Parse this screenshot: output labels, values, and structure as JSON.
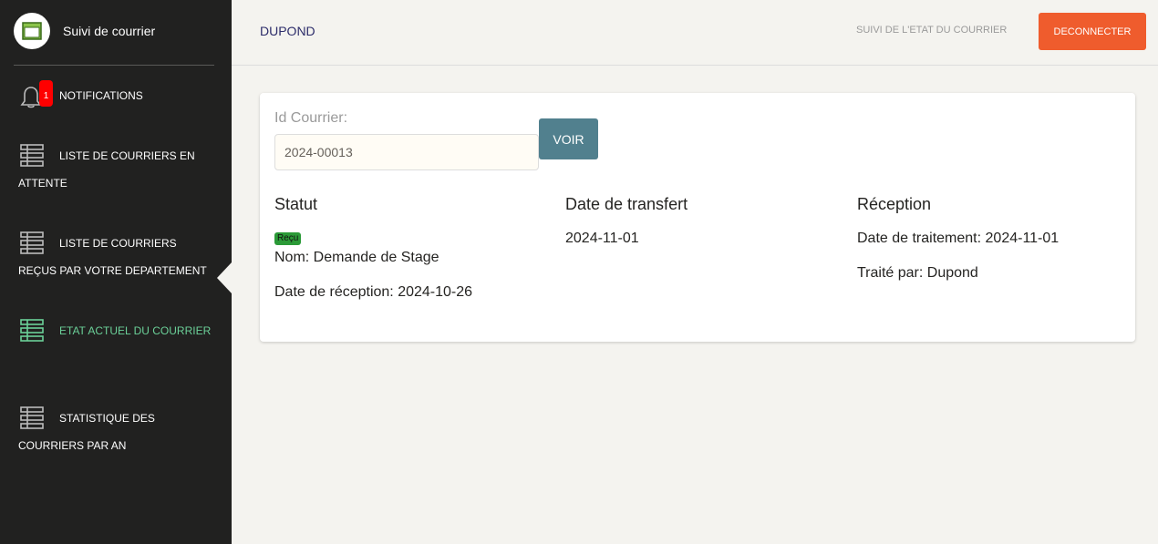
{
  "sidebar": {
    "brand_title": "Suivi de courrier",
    "notification_count": "1",
    "items": [
      {
        "label": "NOTIFICATIONS",
        "icon": "bell-icon"
      },
      {
        "label": "LISTE DE COURRIERS EN ATTENTE",
        "icon": "list-icon"
      },
      {
        "label": "LISTE DE COURRIERS REÇUS PAR VOTRE DEPARTEMENT",
        "icon": "list-icon"
      },
      {
        "label": "ETAT ACTUEL DU COURRIER",
        "icon": "list-icon",
        "active": true
      },
      {
        "label": "STATISTIQUE DES COURRIERS PAR AN",
        "icon": "list-icon"
      }
    ]
  },
  "header": {
    "user_name": "DUPOND",
    "nav_link": "SUIVI DE L'ETAT DU COURRIER",
    "logout_label": "DECONNECTER"
  },
  "form": {
    "id_label": "Id Courrier:",
    "id_value": "2024-00013",
    "voir_label": "VOIR"
  },
  "details": {
    "statut_heading": "Statut",
    "status_badge": "Reçu",
    "nom": "Nom: Demande de Stage",
    "date_reception": "Date de réception: 2024-10-26",
    "transfert_heading": "Date de transfert",
    "date_transfert": "2024-11-01",
    "reception_heading": "Réception",
    "date_traitement": "Date de traitement: 2024-11-01",
    "traite_par": "Traité par: Dupond"
  },
  "colors": {
    "sidebar_bg": "#212120",
    "active": "#6bd098",
    "logout": "#ef5c2d",
    "voir": "#51808e",
    "status_badge": "#2b9a37",
    "notification_badge": "#ff0000"
  }
}
